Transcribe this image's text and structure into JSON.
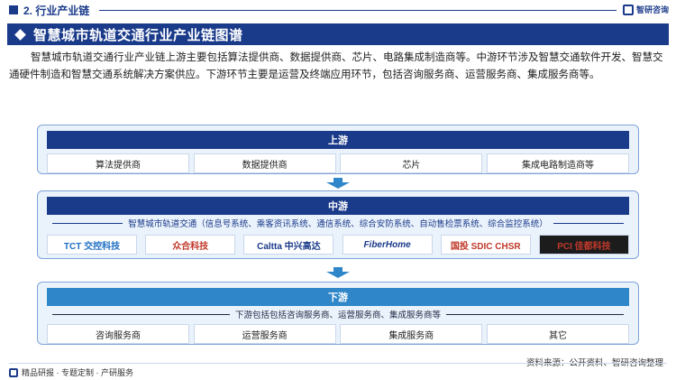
{
  "section": {
    "title": "2. 行业产业链"
  },
  "brand": {
    "name": "智研咨询"
  },
  "banner": {
    "title": "智慧城市轨道交通行业产业链图谱"
  },
  "intro": "智慧城市轨道交通行业产业链上游主要包括算法提供商、数据提供商、芯片、电路集成制造商等。中游环节涉及智慧交通软件开发、智慧交通硬件制造和智慧交通系统解决方案供应。下游环节主要是运营及终端应用环节，包括咨询服务商、运营服务商、集成服务商等。",
  "upstream": {
    "label": "上游",
    "items": [
      "算法提供商",
      "数据提供商",
      "芯片",
      "集成电路制造商等"
    ]
  },
  "midstream": {
    "label": "中游",
    "subtitle": "智慧城市轨道交通（信息号系统、乘客资讯系统、通信系统、综合安防系统、自动售检票系统、综合监控系统）",
    "logos": [
      {
        "name": "TCT 交控科技",
        "color": "#1f6fc4"
      },
      {
        "name": "众合科技",
        "color": "#c0392b"
      },
      {
        "name": "Caltta 中兴高达",
        "color": "#1a3a8a"
      },
      {
        "name": "FiberHome",
        "color": "#1a3a8a"
      },
      {
        "name": "国投 SDIC CHSR",
        "color": "#c0392b"
      },
      {
        "name": "PCI 佳都科技",
        "color": "#c0392b"
      }
    ]
  },
  "downstream": {
    "label": "下游",
    "subtitle": "下游包括包括咨询服务商、运营服务商、集成服务商等",
    "items": [
      "咨询服务商",
      "运营服务商",
      "集成服务商",
      "其它"
    ]
  },
  "footer": {
    "left": "精品研报 · 专题定制 · 产研服务",
    "source": "资料来源：公开资料、智研咨询整理"
  }
}
